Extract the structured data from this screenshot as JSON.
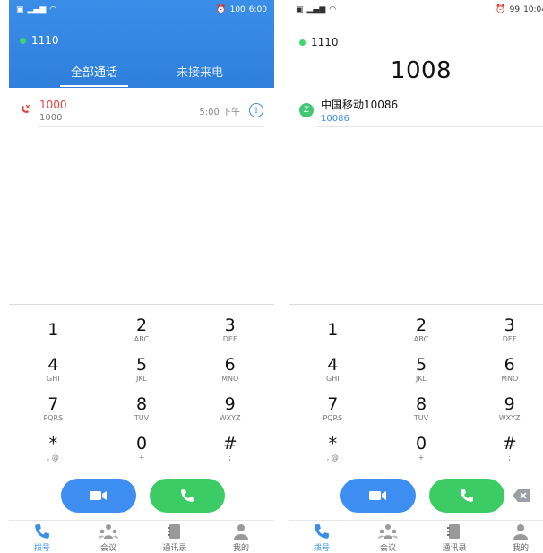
{
  "left": {
    "status": {
      "time": "6:00",
      "battery": "100"
    },
    "account": "1110",
    "tabs": [
      "全部通话",
      "未接来电"
    ],
    "calls": [
      {
        "name": "1000",
        "number": "1000",
        "time": "5:00 下午"
      }
    ]
  },
  "right": {
    "status": {
      "time": "10:04",
      "battery": "99"
    },
    "account": "1110",
    "dialed": "1008",
    "contact": {
      "initial": "Z",
      "name": "中国移动10086",
      "number": "10086"
    }
  },
  "keypad": [
    {
      "digit": "1",
      "letters": ""
    },
    {
      "digit": "2",
      "letters": "ABC"
    },
    {
      "digit": "3",
      "letters": "DEF"
    },
    {
      "digit": "4",
      "letters": "GHI"
    },
    {
      "digit": "5",
      "letters": "JKL"
    },
    {
      "digit": "6",
      "letters": "MNO"
    },
    {
      "digit": "7",
      "letters": "PQRS"
    },
    {
      "digit": "8",
      "letters": "TUV"
    },
    {
      "digit": "9",
      "letters": "WXYZ"
    },
    {
      "digit": "*",
      "letters": ", @"
    },
    {
      "digit": "0",
      "letters": "+"
    },
    {
      "digit": "#",
      "letters": ";"
    }
  ],
  "nav": [
    "拨号",
    "会议",
    "通讯录",
    "我的"
  ],
  "colors": {
    "accent": "#3a8ee8",
    "call_green": "#3ccc66",
    "missed_red": "#e8433a"
  }
}
